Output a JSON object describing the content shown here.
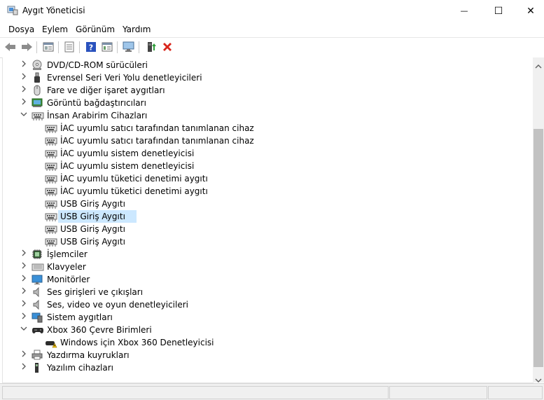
{
  "window": {
    "title": "Aygıt Yöneticisi",
    "minimize_glyph": "—",
    "maximize_glyph": "☐",
    "close_glyph": "✕"
  },
  "menu": {
    "items": [
      "Dosya",
      "Eylem",
      "Görünüm",
      "Yardım"
    ]
  },
  "toolbar": {
    "icons": [
      "back-arrow-icon",
      "forward-arrow-icon",
      "properties-icon",
      "console-tree-icon",
      "help-icon",
      "view-icon",
      "scan-hardware-icon",
      "update-driver-icon",
      "uninstall-icon"
    ]
  },
  "tree": {
    "items": [
      {
        "label": "DVD/CD-ROM sürücüleri",
        "icon": "dvd-drive-icon",
        "expanded": false
      },
      {
        "label": "Evrensel Seri Veri Yolu denetleyicileri",
        "icon": "usb-icon",
        "expanded": false
      },
      {
        "label": "Fare ve diğer işaret aygıtları",
        "icon": "mouse-icon",
        "expanded": false
      },
      {
        "label": "Görüntü bağdaştırıcıları",
        "icon": "display-adapter-icon",
        "expanded": false
      },
      {
        "label": "İnsan Arabirim Cihazları",
        "icon": "hid-icon",
        "expanded": true
      },
      {
        "label": "İAC uyumlu satıcı tarafından tanımlanan cihaz",
        "icon": "hid-icon",
        "child": true
      },
      {
        "label": "İAC uyumlu satıcı tarafından tanımlanan cihaz",
        "icon": "hid-icon",
        "child": true
      },
      {
        "label": "İAC uyumlu sistem denetleyicisi",
        "icon": "hid-icon",
        "child": true
      },
      {
        "label": "İAC uyumlu sistem denetleyicisi",
        "icon": "hid-icon",
        "child": true
      },
      {
        "label": "İAC uyumlu tüketici denetimi aygıtı",
        "icon": "hid-icon",
        "child": true
      },
      {
        "label": "İAC uyumlu tüketici denetimi aygıtı",
        "icon": "hid-icon",
        "child": true
      },
      {
        "label": "USB Giriş Aygıtı",
        "icon": "hid-icon",
        "child": true
      },
      {
        "label": "USB Giriş Aygıtı",
        "icon": "hid-icon",
        "child": true,
        "selected": true
      },
      {
        "label": "USB Giriş Aygıtı",
        "icon": "hid-icon",
        "child": true
      },
      {
        "label": "USB Giriş Aygıtı",
        "icon": "hid-icon",
        "child": true
      },
      {
        "label": "İşlemciler",
        "icon": "processor-icon",
        "expanded": false
      },
      {
        "label": "Klavyeler",
        "icon": "keyboard-icon",
        "expanded": false
      },
      {
        "label": "Monitörler",
        "icon": "monitor-icon",
        "expanded": false
      },
      {
        "label": "Ses girişleri ve çıkışları",
        "icon": "speaker-icon",
        "expanded": false
      },
      {
        "label": "Ses, video ve oyun denetleyicileri",
        "icon": "speaker-icon",
        "expanded": false
      },
      {
        "label": "Sistem aygıtları",
        "icon": "system-devices-icon",
        "expanded": false
      },
      {
        "label": "Xbox 360 Çevre Birimleri",
        "icon": "gamepad-icon",
        "expanded": true
      },
      {
        "label": "Windows için Xbox 360 Denetleyicisi",
        "icon": "warning-icon",
        "child": true
      },
      {
        "label": "Yazdırma kuyrukları",
        "icon": "printer-icon",
        "expanded": false
      },
      {
        "label": "Yazılım cihazları",
        "icon": "software-device-icon",
        "expanded": false
      }
    ]
  },
  "colors": {
    "selection": "#cce8ff",
    "warning": "#f5c400",
    "uninstall_red": "#d9261c",
    "help_blue": "#2a52be"
  }
}
